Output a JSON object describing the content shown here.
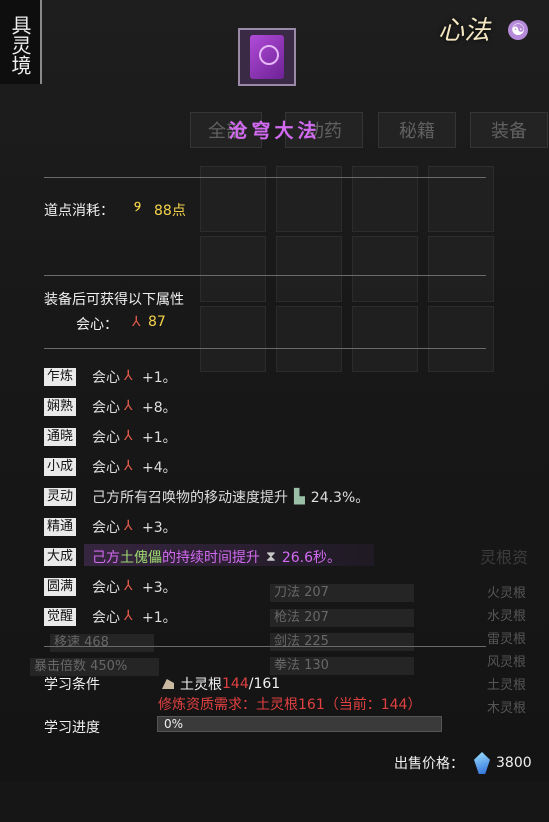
{
  "realm": {
    "label": "具灵境"
  },
  "header": {
    "xinfa_label": "心法",
    "yinyang_glyph": "☯"
  },
  "background": {
    "tabs": [
      "全部",
      "功药",
      "秘籍",
      "装备"
    ],
    "stats_left": [
      "刀法 207",
      "枪法 207",
      "剑法 225",
      "拳法 130"
    ],
    "stats_misc": [
      "移速 468",
      "暴击倍数 450%"
    ],
    "side_title": "灵根资",
    "side_items": [
      "火灵根",
      "水灵根",
      "雷灵根",
      "风灵根",
      "土灵根",
      "木灵根"
    ]
  },
  "book": {
    "icon": "purple-book-icon",
    "title": "沧穹大法",
    "title_color": "#d36af2"
  },
  "cost": {
    "label": "道点消耗：",
    "value": "88点"
  },
  "bonus": {
    "header": "装备后可获得以下属性",
    "stat_label": "会心：",
    "stat_value": "87"
  },
  "levels": [
    {
      "tag": "乍炼",
      "text": "会心",
      "value": "+1。"
    },
    {
      "tag": "娴熟",
      "text": "会心",
      "value": "+8。"
    },
    {
      "tag": "通晓",
      "text": "会心",
      "value": "+1。"
    },
    {
      "tag": "小成",
      "text": "会心",
      "value": "+4。"
    },
    {
      "tag": "灵动",
      "text": "己方所有召唤物的移动速度提升",
      "value": "24.3%。"
    },
    {
      "tag": "精通",
      "text": "会心",
      "value": "+3。"
    },
    {
      "tag": "大成",
      "text_pre": "己方",
      "text_green": "土傀儡",
      "text_post": "的持续时间提升",
      "value": "26.6秒。"
    },
    {
      "tag": "圆满",
      "text": "会心",
      "value": "+3。"
    },
    {
      "tag": "觉醒",
      "text": "会心",
      "value": "+1。"
    }
  ],
  "learn": {
    "condition_label": "学习条件",
    "root_name": "土灵根",
    "root_current": "144",
    "root_required": "/161",
    "requirement_text": "修炼资质需求：土灵根161（当前：144）",
    "progress_label": "学习进度",
    "progress_text": "0%",
    "progress_value": 0
  },
  "sale": {
    "label": "出售价格：",
    "value": "3800"
  }
}
